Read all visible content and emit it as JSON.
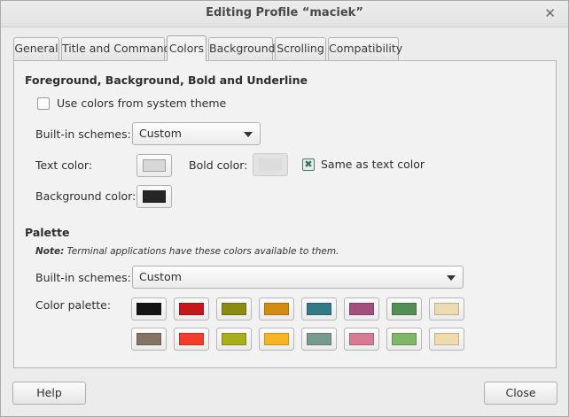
{
  "window": {
    "title": "Editing Profile “maciek”",
    "close_glyph": "✕"
  },
  "tabs": [
    {
      "label": "General"
    },
    {
      "label": "Title and Command"
    },
    {
      "label": "Colors",
      "active": true
    },
    {
      "label": "Background"
    },
    {
      "label": "Scrolling"
    },
    {
      "label": "Compatibility"
    }
  ],
  "fg_section": {
    "title": "Foreground, Background, Bold and Underline",
    "use_system_theme": {
      "label": "Use colors from system theme",
      "checked": false
    },
    "builtin_label": "Built-in schemes:",
    "builtin_value": "Custom",
    "text_color_label": "Text color:",
    "text_color": "#d8d8d8",
    "bold_color_label": "Bold color:",
    "bold_color": "#dcdcdc",
    "same_as_text": {
      "label": "Same as text color",
      "checked": true,
      "glyph": "✖"
    },
    "bg_color_label": "Background color:",
    "bg_color": "#262626"
  },
  "palette_section": {
    "title": "Palette",
    "note_bold": "Note:",
    "note_text": " Terminal applications have these colors available to them.",
    "builtin_label": "Built-in schemes:",
    "builtin_value": "Custom",
    "palette_label": "Color palette:",
    "row1": [
      "#141414",
      "#c4161b",
      "#8b8b12",
      "#d48b14",
      "#327a85",
      "#a34f7e",
      "#538f55",
      "#ecdcb3"
    ],
    "row2": [
      "#857363",
      "#f23d2a",
      "#a9ae1c",
      "#f7b524",
      "#7b9a8f",
      "#d77a96",
      "#80b766",
      "#efdcac"
    ]
  },
  "buttons": {
    "help": "Help",
    "close": "Close"
  }
}
